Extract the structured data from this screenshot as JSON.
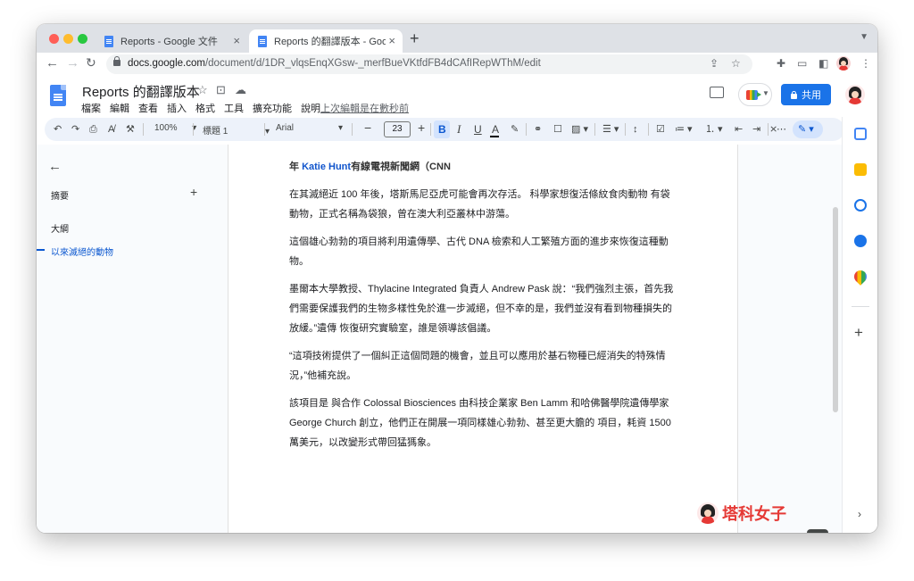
{
  "browser": {
    "tabs": [
      {
        "title": "Reports - Google 文件",
        "close": "×"
      },
      {
        "title": "Reports 的翻譯版本 - Google 文件",
        "close": "×"
      }
    ],
    "new_tab": "+",
    "url_host": "docs.google.com",
    "url_path": "/document/d/1DR_vlqsEnqXGsw-_merfBueVKtfdFB4dCAfIRepWThM/edit"
  },
  "docs": {
    "title": "Reports 的翻譯版本",
    "menus": [
      "檔案",
      "編輯",
      "查看",
      "插入",
      "格式",
      "工具",
      "擴充功能",
      "說明"
    ],
    "last_edit": "上次編輯是在數秒前",
    "share_label": "共用",
    "accent": "#1a73e8"
  },
  "toolbar": {
    "zoom": "100%",
    "style": "標題 1",
    "font": "Arial",
    "font_size": "23",
    "bold": "B",
    "italic": "I",
    "underline": "U",
    "text_color": "A"
  },
  "outline": {
    "summary": "摘要",
    "outline_label": "大綱",
    "items": [
      "以來滅絕的動物"
    ]
  },
  "document": {
    "heading_prefix": "年 ",
    "heading_link": "Katie Hunt",
    "heading_suffix": "有線電視新聞網（CNN",
    "paragraphs": [
      "在其滅絕近 100 年後，塔斯馬尼亞虎可能會再次存活。 科學家想復活條紋食肉動物 有袋動物，正式名稱為袋狼，曾在澳大利亞叢林中游蕩。",
      "這個雄心勃勃的項目將利用遺傳學、古代 DNA 檢索和人工繁殖方面的進步來恢復這種動物。",
      "墨爾本大學教授、Thylacine Integrated 負責人 Andrew Pask 說：“我們強烈主張，首先我們需要保護我們的生物多樣性免於進一步滅絕，但不幸的是，我們並沒有看到物種損失的放緩。”遺傳 恢復研究實驗室，誰是領導該倡議。",
      "“這項技術提供了一個糾正這個問題的機會，並且可以應用於基石物種已經消失的特殊情況，”他補充說。",
      "該項目是 與合作 Colossal Biosciences 由科技企業家 Ben Lamm 和哈佛醫學院遺傳學家 George Church 創立，他們正在開展一項同樣雄心勃勃、甚至更大膽的 項目，耗資 1500 萬美元，以改變形式帶回猛獁象。"
    ]
  },
  "watermark": {
    "text": "塔科女子"
  }
}
